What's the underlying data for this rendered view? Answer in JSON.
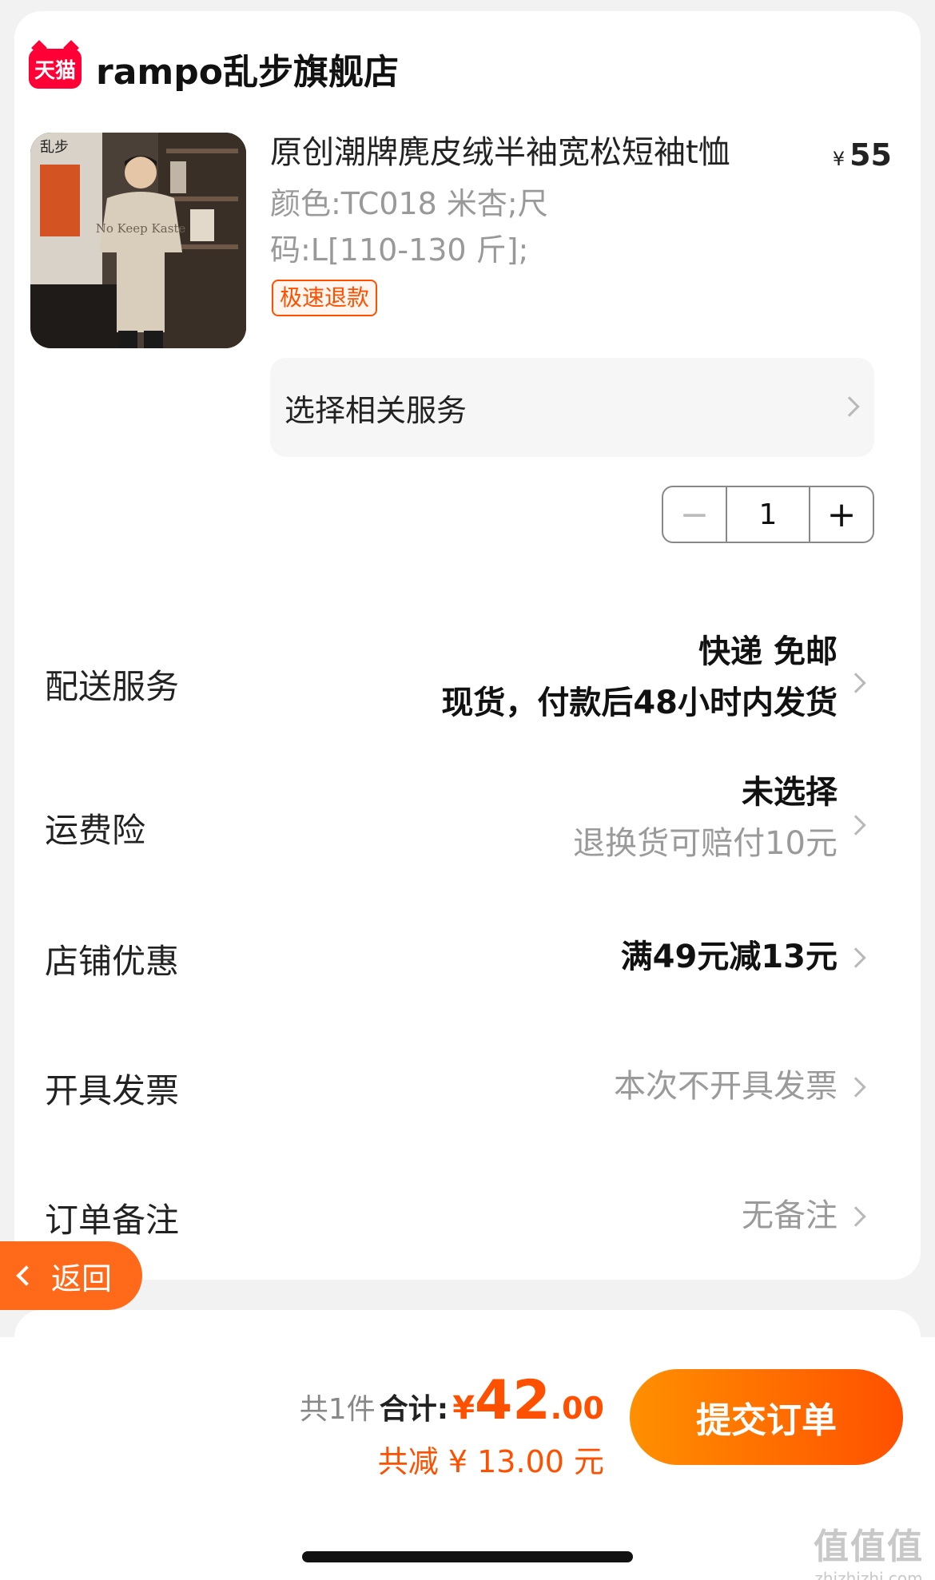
{
  "shop": {
    "badge": "天猫",
    "name": "rampo乱步旗舰店"
  },
  "product": {
    "title": "原创潮牌麂皮绒半袖宽松短袖t恤",
    "currency": "¥",
    "price": "55",
    "spec_line1": "颜色:TC018 米杏;尺",
    "spec_line2": "码:L[110-130 斤];",
    "tag": "极速退款",
    "image_text": "乱步",
    "shirt_print": "No Keep Kaste"
  },
  "service": {
    "label": "选择相关服务"
  },
  "quantity": {
    "minus": "−",
    "value": "1",
    "plus": "+"
  },
  "rows": {
    "delivery": {
      "label": "配送服务",
      "line1": "快递 免邮",
      "line2": "现货，付款后48小时内发货"
    },
    "insurance": {
      "label": "运费险",
      "line1": "未选择",
      "line2": "退换货可赔付10元"
    },
    "coupon": {
      "label": "店铺优惠",
      "value": "满49元减13元"
    },
    "invoice": {
      "label": "开具发票",
      "value": "本次不开具发票"
    },
    "remark": {
      "label": "订单备注",
      "value": "无备注"
    }
  },
  "back": {
    "label": "返回"
  },
  "footer": {
    "count": "共1件",
    "total_label": "合计:",
    "currency": "¥",
    "amount_int": "42",
    "amount_dec": ".00",
    "discount": "共减 ¥ 13.00 元",
    "submit": "提交订单"
  },
  "watermark": {
    "title": "值值值",
    "site": "zhizhizhi.com"
  },
  "colors": {
    "accent": "#ff5000",
    "tmall": "#ff0036",
    "back_button": "#ff6a1a"
  }
}
